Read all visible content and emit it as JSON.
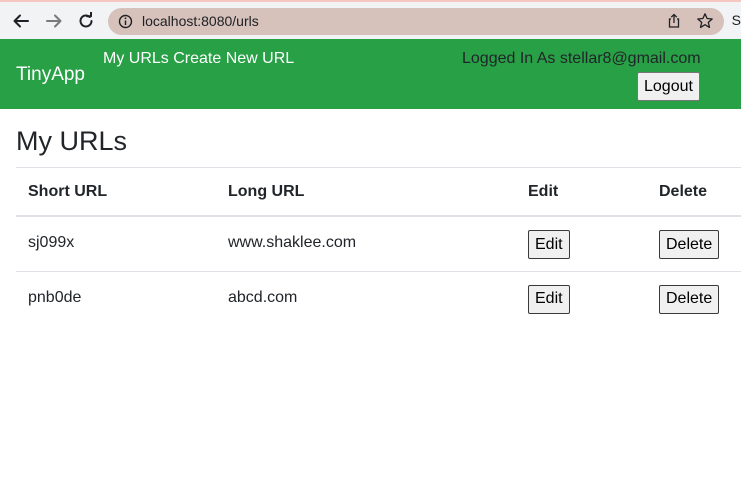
{
  "browser": {
    "url": "localhost:8080/urls",
    "edge_glyph": "S"
  },
  "navbar": {
    "brand": "TinyApp",
    "my_urls": "My URLs",
    "create_new_url": "Create New URL",
    "logged_in_text": "Logged In As stellar8@gmail.com",
    "logout_label": "Logout"
  },
  "main": {
    "title": "My URLs",
    "table": {
      "headers": [
        "Short URL",
        "Long URL",
        "Edit",
        "Delete"
      ],
      "rows": [
        {
          "short": "sj099x",
          "long": "www.shaklee.com",
          "edit": "Edit",
          "delete": "Delete"
        },
        {
          "short": "pnb0de",
          "long": "abcd.com",
          "edit": "Edit",
          "delete": "Delete"
        }
      ]
    }
  },
  "colors": {
    "navbar_bg": "#28a046",
    "omnibox_bg": "#d6c1bb"
  }
}
